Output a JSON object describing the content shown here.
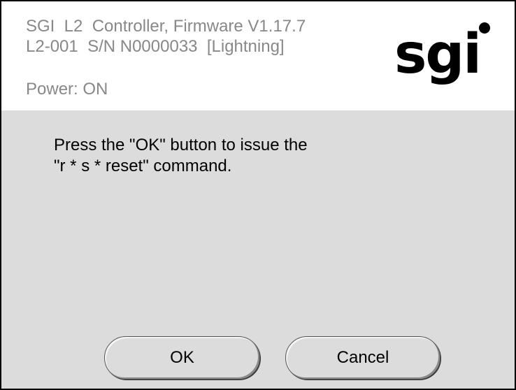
{
  "header": {
    "line1": "SGI  L2  Controller, Firmware V1.17.7",
    "line2": "L2-001  S/N N0000033  [Lightning]",
    "power_status": "Power: ON",
    "logo_text": "sgi"
  },
  "dialog": {
    "message_line1": "Press the \"OK\" button to issue the",
    "message_line2": "\"r * s * reset\" command.",
    "ok_label": "OK",
    "cancel_label": "Cancel"
  },
  "colors": {
    "header_text": "#888888",
    "body_background": "#dcdcdc",
    "frame_border": "#000000"
  }
}
